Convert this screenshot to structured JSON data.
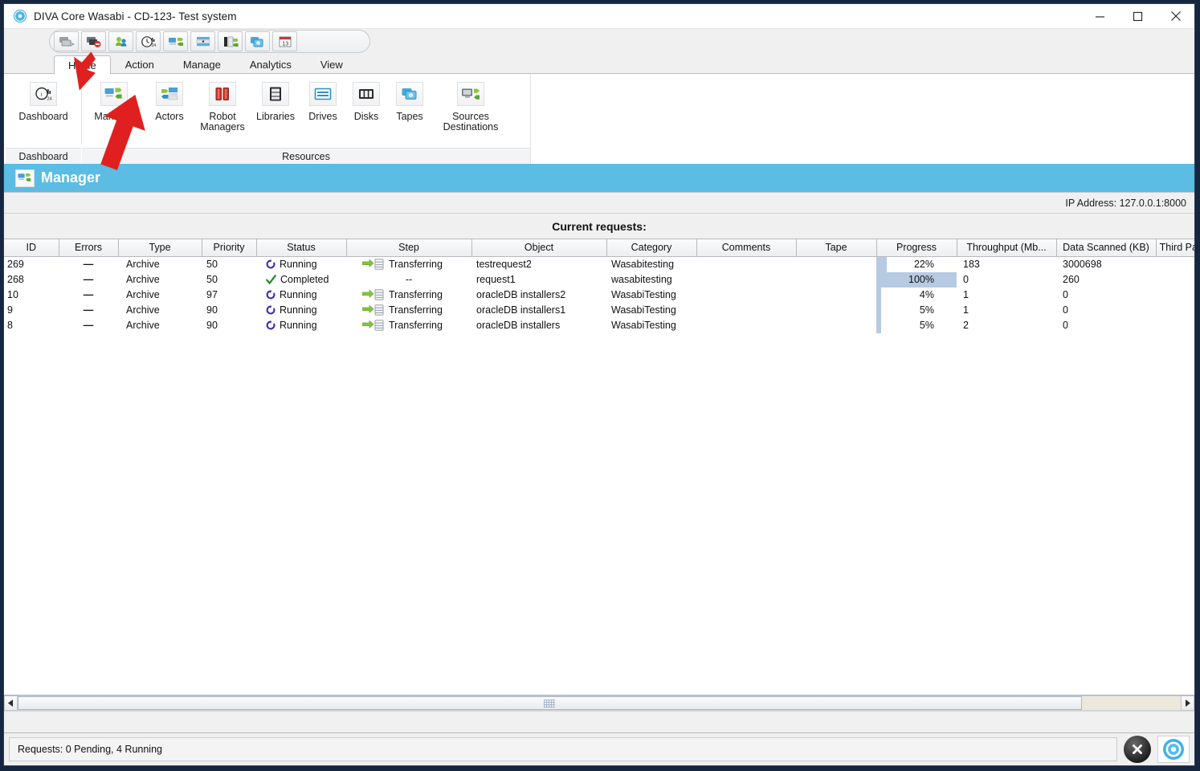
{
  "window": {
    "title": "DIVA Core  Wasabi - CD-123- Test system",
    "icon": "diva-logo-icon",
    "controls": [
      {
        "name": "minimize-button",
        "glyph": "—"
      },
      {
        "name": "maximize-button",
        "glyph": "☐"
      },
      {
        "name": "close-button",
        "glyph": "✕"
      }
    ]
  },
  "quick_access": {
    "buttons": [
      {
        "name": "new-request-icon",
        "tooltip": "New Request"
      },
      {
        "name": "cancel-request-icon",
        "tooltip": "Cancel Request"
      },
      {
        "name": "users-icon",
        "tooltip": "Users"
      },
      {
        "name": "clock-stats-icon",
        "tooltip": "History"
      },
      {
        "name": "manager-icon",
        "tooltip": "Manager"
      },
      {
        "name": "server-icon",
        "tooltip": "Server"
      },
      {
        "name": "storage-sync-icon",
        "tooltip": "Storage"
      },
      {
        "name": "disks-copy-icon",
        "tooltip": "Disks"
      },
      {
        "name": "calendar-icon",
        "tooltip": "Schedule"
      }
    ]
  },
  "ribbon": {
    "tabs": [
      {
        "label": "Home",
        "active": true
      },
      {
        "label": "Action",
        "active": false
      },
      {
        "label": "Manage",
        "active": false
      },
      {
        "label": "Analytics",
        "active": false
      },
      {
        "label": "View",
        "active": false
      }
    ],
    "groups": [
      {
        "label": "Dashboard",
        "buttons": [
          {
            "label": "Dashboard",
            "icon": "dashboard-gauge-icon"
          }
        ]
      },
      {
        "label": "Resources",
        "buttons": [
          {
            "label": "Manager",
            "icon": "manager-icon"
          },
          {
            "label": "Actors",
            "icon": "actors-icon"
          },
          {
            "label": "Robot\nManagers",
            "icon": "robot-managers-icon"
          },
          {
            "label": "Libraries",
            "icon": "libraries-icon"
          },
          {
            "label": "Drives",
            "icon": "drives-icon"
          },
          {
            "label": "Disks",
            "icon": "disks-icon"
          },
          {
            "label": "Tapes",
            "icon": "tapes-icon"
          },
          {
            "label": "Sources\nDestinations",
            "icon": "sources-destinations-icon"
          }
        ]
      }
    ]
  },
  "page": {
    "banner_title": "Manager",
    "banner_icon": "manager-icon",
    "banner_color": "#5bbce4",
    "ip_address": "IP Address: 127.0.0.1:8000",
    "section_title": "Current requests:"
  },
  "table": {
    "columns": [
      "ID",
      "Errors",
      "Type",
      "Priority",
      "Status",
      "Step",
      "Object",
      "Category",
      "Comments",
      "Tape",
      "Progress",
      "Throughput (Mb...",
      "Data Scanned (KB)",
      "Third Party"
    ],
    "rows": [
      {
        "id": "269",
        "errors": "—",
        "type": "Archive",
        "priority": "50",
        "status": "Running",
        "status_icon": "running-icon",
        "step": "Transferring",
        "step_icon": "transfer-icon",
        "object": "testrequest2",
        "category": "Wasabitesting",
        "comments": "",
        "tape": "",
        "progress": "22%",
        "progress_value": 22,
        "throughput": "183",
        "data_scanned": "3000698",
        "third_party": ""
      },
      {
        "id": "268",
        "errors": "—",
        "type": "Archive",
        "priority": "50",
        "status": "Completed",
        "status_icon": "completed-check-icon",
        "step": "--",
        "step_icon": "",
        "object": "request1",
        "category": "wasabitesting",
        "comments": "",
        "tape": "",
        "progress": "100%",
        "progress_value": 100,
        "throughput": "0",
        "data_scanned": "260",
        "third_party": ""
      },
      {
        "id": "10",
        "errors": "—",
        "type": "Archive",
        "priority": "97",
        "status": "Running",
        "status_icon": "running-icon",
        "step": "Transferring",
        "step_icon": "transfer-icon",
        "object": "oracleDB installers2",
        "category": "WasabiTesting",
        "comments": "",
        "tape": "",
        "progress": "4%",
        "progress_value": 4,
        "throughput": "1",
        "data_scanned": "0",
        "third_party": ""
      },
      {
        "id": "9",
        "errors": "—",
        "type": "Archive",
        "priority": "90",
        "status": "Running",
        "status_icon": "running-icon",
        "step": "Transferring",
        "step_icon": "transfer-icon",
        "object": "oracleDB installers1",
        "category": "WasabiTesting",
        "comments": "",
        "tape": "",
        "progress": "5%",
        "progress_value": 5,
        "throughput": "1",
        "data_scanned": "0",
        "third_party": ""
      },
      {
        "id": "8",
        "errors": "—",
        "type": "Archive",
        "priority": "90",
        "status": "Running",
        "status_icon": "running-icon",
        "step": "Transferring",
        "step_icon": "transfer-icon",
        "object": "oracleDB installers",
        "category": "WasabiTesting",
        "comments": "",
        "tape": "",
        "progress": "5%",
        "progress_value": 5,
        "throughput": "2",
        "data_scanned": "0",
        "third_party": ""
      }
    ]
  },
  "statusbar": {
    "text": "Requests: 0 Pending, 4 Running",
    "close_icon": "close-circle-icon",
    "logo_icon": "diva-logo-icon"
  },
  "annotations": [
    {
      "name": "arrow-to-home-tab",
      "color": "#e02020"
    },
    {
      "name": "arrow-to-manager-button",
      "color": "#e02020"
    }
  ]
}
